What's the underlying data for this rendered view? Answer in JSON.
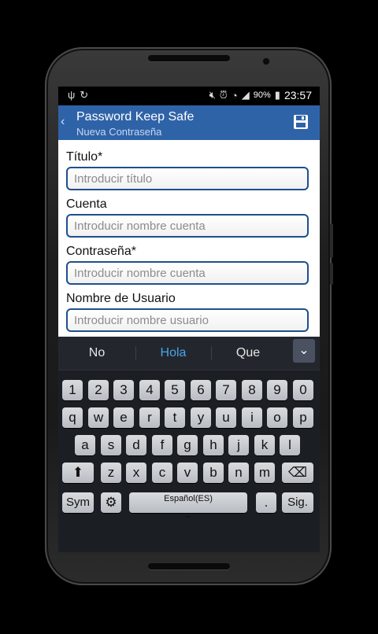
{
  "status_bar": {
    "icons_left": [
      "usb-icon",
      "sync-icon"
    ],
    "icons_right": [
      "mute-icon",
      "alarm-icon",
      "wifi-icon",
      "signal-icon"
    ],
    "battery": "90%",
    "time": "23:57"
  },
  "action_bar": {
    "title": "Password Keep Safe",
    "subtitle": "Nueva Contraseña",
    "back_icon": "‹",
    "save_icon": "save-icon",
    "accent": "#2f63a8"
  },
  "form": {
    "fields": [
      {
        "label": "Título*",
        "placeholder": "Introducir título",
        "value": ""
      },
      {
        "label": "Cuenta",
        "placeholder": "Introducir nombre cuenta",
        "value": ""
      },
      {
        "label": "Contraseña*",
        "placeholder": "Introducir nombre cuenta",
        "value": ""
      },
      {
        "label": "Nombre de Usuario",
        "placeholder": "Introducir nombre usuario",
        "value": ""
      }
    ]
  },
  "keyboard": {
    "suggestions": [
      "No",
      "Hola",
      "Que"
    ],
    "highlight_color": "#4aa3e8",
    "rows": {
      "numbers": [
        "1",
        "2",
        "3",
        "4",
        "5",
        "6",
        "7",
        "8",
        "9",
        "0"
      ],
      "row1": [
        "q",
        "w",
        "e",
        "r",
        "t",
        "y",
        "u",
        "i",
        "o",
        "p"
      ],
      "row2": [
        "a",
        "s",
        "d",
        "f",
        "g",
        "h",
        "j",
        "k",
        "l"
      ],
      "row3": [
        "z",
        "x",
        "c",
        "v",
        "b",
        "n",
        "m"
      ]
    },
    "sym_label": "Sym",
    "space_label": "Español(ES)",
    "period_label": ".",
    "next_label": "Sig."
  }
}
